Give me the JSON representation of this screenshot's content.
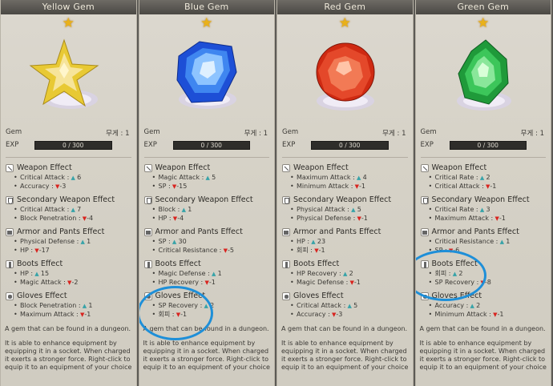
{
  "colors": {
    "accent_circle": "#1e8fd8",
    "up": "#37a3a8",
    "down": "#d8241f",
    "star": "#e9b11a"
  },
  "panels": [
    {
      "title": "Yellow Gem",
      "star": "★",
      "gem_label": "Gem",
      "weight": "무게 : 1",
      "exp_label": "EXP",
      "exp_value": "0 / 300",
      "gem_icon": "yellow-star-gem",
      "effects": [
        {
          "title": "Weapon Effect",
          "icon": "weapon",
          "stats": [
            {
              "name": "Critical Attack :",
              "dir": "up",
              "value": "6"
            },
            {
              "name": "Accuracy :",
              "dir": "down",
              "value": "-3"
            }
          ]
        },
        {
          "title": "Secondary Weapon Effect",
          "icon": "secondary",
          "stats": [
            {
              "name": "Critical Attack :",
              "dir": "up",
              "value": "7"
            },
            {
              "name": "Block Penetration :",
              "dir": "down",
              "value": "-4"
            }
          ]
        },
        {
          "title": "Armor and Pants Effect",
          "icon": "armor",
          "stats": [
            {
              "name": "Physical Defense :",
              "dir": "up",
              "value": "1"
            },
            {
              "name": "HP :",
              "dir": "down",
              "value": "-17"
            }
          ]
        },
        {
          "title": "Boots Effect",
          "icon": "boots",
          "stats": [
            {
              "name": "HP :",
              "dir": "up",
              "value": "15"
            },
            {
              "name": "Magic Attack :",
              "dir": "down",
              "value": "-2"
            }
          ]
        },
        {
          "title": "Gloves Effect",
          "icon": "gloves",
          "stats": [
            {
              "name": "Block Penetration :",
              "dir": "up",
              "value": "1"
            },
            {
              "name": "Maximum Attack :",
              "dir": "down",
              "value": "-1"
            }
          ]
        }
      ],
      "desc1": "A gem that can be found in a dungeon.",
      "desc2": "It is able to enhance equipment by equipping it in a socket. When charged it exerts a stronger force. Right-click to equip it to an equipment of your choice"
    },
    {
      "title": "Blue Gem",
      "star": "★",
      "gem_label": "Gem",
      "weight": "무게 : 1",
      "exp_label": "EXP",
      "exp_value": "0 / 300",
      "gem_icon": "blue-cushion-gem",
      "effects": [
        {
          "title": "Weapon Effect",
          "icon": "weapon",
          "stats": [
            {
              "name": "Magic Attack :",
              "dir": "up",
              "value": "5"
            },
            {
              "name": "SP :",
              "dir": "down",
              "value": "-15"
            }
          ]
        },
        {
          "title": "Secondary Weapon Effect",
          "icon": "secondary",
          "stats": [
            {
              "name": "Block :",
              "dir": "up",
              "value": "1"
            },
            {
              "name": "HP :",
              "dir": "down",
              "value": "-4"
            }
          ]
        },
        {
          "title": "Armor and Pants Effect",
          "icon": "armor",
          "stats": [
            {
              "name": "SP :",
              "dir": "up",
              "value": "30"
            },
            {
              "name": "Critical Resistance :",
              "dir": "down",
              "value": "-5"
            }
          ]
        },
        {
          "title": "Boots Effect",
          "icon": "boots",
          "stats": [
            {
              "name": "Magic Defense :",
              "dir": "up",
              "value": "1"
            },
            {
              "name": "HP Recovery :",
              "dir": "down",
              "value": "-1"
            }
          ]
        },
        {
          "title": "Gloves Effect",
          "icon": "gloves",
          "stats": [
            {
              "name": "SP Recovery :",
              "dir": "up",
              "value": "2"
            },
            {
              "name": "회피 :",
              "dir": "down",
              "value": "-1"
            }
          ]
        }
      ],
      "desc1": "A gem that can be found in a dungeon.",
      "desc2": "It is able to enhance equipment by equipping it in a socket. When charged it exerts a stronger force. Right-click to equip it to an equipment of your choice"
    },
    {
      "title": "Red Gem",
      "star": "★",
      "gem_label": "Gem",
      "weight": "무게 : 1",
      "exp_label": "EXP",
      "exp_value": "0 / 300",
      "gem_icon": "red-round-gem",
      "effects": [
        {
          "title": "Weapon Effect",
          "icon": "weapon",
          "stats": [
            {
              "name": "Maximum Attack :",
              "dir": "up",
              "value": "4"
            },
            {
              "name": "Minimum Attack :",
              "dir": "down",
              "value": "-1"
            }
          ]
        },
        {
          "title": "Secondary Weapon Effect",
          "icon": "secondary",
          "stats": [
            {
              "name": "Physical Attack :",
              "dir": "up",
              "value": "5"
            },
            {
              "name": "Physical Defense :",
              "dir": "down",
              "value": "-1"
            }
          ]
        },
        {
          "title": "Armor and Pants Effect",
          "icon": "armor",
          "stats": [
            {
              "name": "HP :",
              "dir": "up",
              "value": "23"
            },
            {
              "name": "회피 :",
              "dir": "down",
              "value": "-1"
            }
          ]
        },
        {
          "title": "Boots Effect",
          "icon": "boots",
          "stats": [
            {
              "name": "HP Recovery :",
              "dir": "up",
              "value": "2"
            },
            {
              "name": "Magic Defense :",
              "dir": "down",
              "value": "-1"
            }
          ]
        },
        {
          "title": "Gloves Effect",
          "icon": "gloves",
          "stats": [
            {
              "name": "Critical Attack :",
              "dir": "up",
              "value": "5"
            },
            {
              "name": "Accuracy :",
              "dir": "down",
              "value": "-3"
            }
          ]
        }
      ],
      "desc1": "A gem that can be found in a dungeon.",
      "desc2": "It is able to enhance equipment by equipping it in a socket. When charged it exerts a stronger force. Right-click to equip it to an equipment of your choice"
    },
    {
      "title": "Green Gem",
      "star": "★",
      "gem_label": "Gem",
      "weight": "무게 : 1",
      "exp_label": "EXP",
      "exp_value": "0 / 300",
      "gem_icon": "green-faceted-gem",
      "effects": [
        {
          "title": "Weapon Effect",
          "icon": "weapon",
          "stats": [
            {
              "name": "Critical Rate :",
              "dir": "up",
              "value": "2"
            },
            {
              "name": "Critical Attack :",
              "dir": "down",
              "value": "-1"
            }
          ]
        },
        {
          "title": "Secondary Weapon Effect",
          "icon": "secondary",
          "stats": [
            {
              "name": "Critical Rate :",
              "dir": "up",
              "value": "3"
            },
            {
              "name": "Maximum Attack :",
              "dir": "down",
              "value": "-1"
            }
          ]
        },
        {
          "title": "Armor and Pants Effect",
          "icon": "armor",
          "stats": [
            {
              "name": "Critical Resistance :",
              "dir": "up",
              "value": "1"
            },
            {
              "name": "SP :",
              "dir": "down",
              "value": "-6"
            }
          ]
        },
        {
          "title": "Boots Effect",
          "icon": "boots",
          "stats": [
            {
              "name": "회피 :",
              "dir": "up",
              "value": "2"
            },
            {
              "name": "SP Recovery :",
              "dir": "down",
              "value": "-8"
            }
          ]
        },
        {
          "title": "Gloves Effect",
          "icon": "gloves",
          "stats": [
            {
              "name": "Accuracy :",
              "dir": "up",
              "value": "2"
            },
            {
              "name": "Minimum Attack :",
              "dir": "down",
              "value": "-1"
            }
          ]
        }
      ],
      "desc1": "A gem that can be found in a dungeon.",
      "desc2": "It is able to enhance equipment by equipping it in a socket. When charged it exerts a stronger force. Right-click to equip it to an equipment of your choice"
    }
  ]
}
